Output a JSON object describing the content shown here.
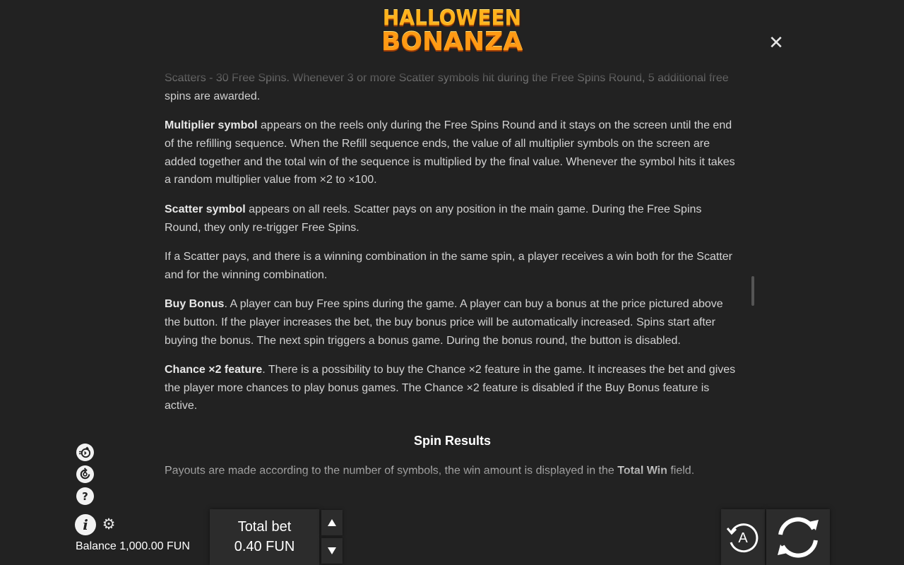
{
  "header": {
    "logo_line1": "HALLOWEEN",
    "logo_line2": "BONANZA",
    "close_glyph": "✕"
  },
  "rules": {
    "p0": "Scatters - 30 Free Spins. Whenever 3 or more Scatter symbols hit during the Free Spins Round, 5 additional free spins are awarded.",
    "p1_bold": "Multiplier symbol",
    "p1_text": " appears on the reels only during the Free Spins Round and it stays on the screen until the end of the refilling sequence. When the Refill sequence ends, the value of all multiplier symbols on the screen are added together and the total win of the sequence is multiplied by the final value. Whenever the symbol hits it takes a random multiplier value from ×2 to ×100.",
    "p2_bold": "Scatter symbol",
    "p2_text": " appears on all reels. Scatter pays on any position in the main game. During the Free Spins Round, they only re-trigger Free Spins.",
    "p3": "If a Scatter pays, and there is a winning combination in the same spin, a player receives a win both for the Scatter and for the winning combination.",
    "p4_bold": "Buy Bonus",
    "p4_text": ". A player can buy Free spins during the game. A player can buy a bonus at the price pictured above the button. If the player increases the bet, the buy bonus price will be automatically increased. Spins start after buying the bonus. The next spin triggers a bonus game. During the bonus round, the button is disabled.",
    "p5_bold": "Chance ×2 feature",
    "p5_text": ". There is a possibility to buy the Chance ×2 feature in the game. It increases the bet and gives the player more chances to play bonus games. The Chance ×2 feature is disabled if the Buy Bonus feature is active.",
    "section_title": "Spin Results",
    "p6_text": "Payouts are made according to the number of symbols, the win amount is displayed in the ",
    "p6_bold": "Total Win",
    "p6_end": " field."
  },
  "sidebar": {
    "help_glyph": "?",
    "info_glyph": "i"
  },
  "footer": {
    "balance": "Balance 1,000.00 FUN",
    "total_bet_label": "Total bet",
    "total_bet_value": "0.40 FUN",
    "auto_label": "A"
  },
  "icons": [
    "turbo-icon",
    "history-icon",
    "help-icon",
    "info-icon",
    "gear-icon",
    "arrow-up-icon",
    "arrow-down-icon",
    "autoplay-icon",
    "spin-icon",
    "close-icon"
  ]
}
